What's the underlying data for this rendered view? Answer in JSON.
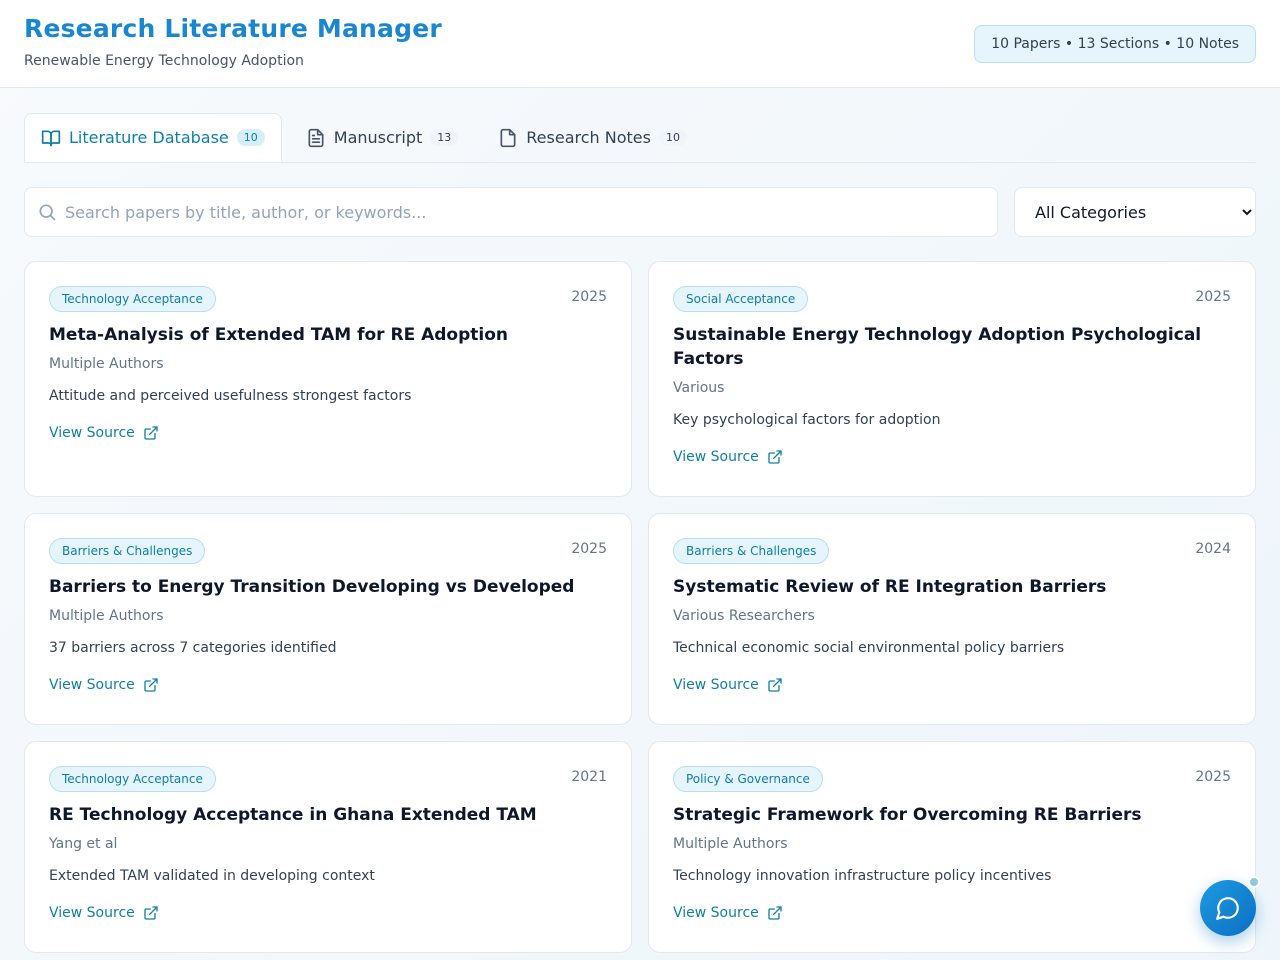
{
  "header": {
    "title": "Research Literature Manager",
    "subtitle": "Renewable Energy Technology Adoption",
    "stats": "10 Papers • 13 Sections • 10 Notes"
  },
  "tabs": [
    {
      "label": "Literature Database",
      "count": "10",
      "icon": "book-open-icon",
      "active": true
    },
    {
      "label": "Manuscript",
      "count": "13",
      "icon": "document-text-icon",
      "active": false
    },
    {
      "label": "Research Notes",
      "count": "10",
      "icon": "file-icon",
      "active": false
    }
  ],
  "search": {
    "placeholder": "Search papers by title, author, or keywords...",
    "value": ""
  },
  "filter": {
    "selected": "All Categories"
  },
  "papers": [
    {
      "category": "Technology Acceptance",
      "year": "2025",
      "title": "Meta-Analysis of Extended TAM for RE Adoption",
      "authors": "Multiple Authors",
      "summary": "Attitude and perceived usefulness strongest factors",
      "link_label": "View Source"
    },
    {
      "category": "Social Acceptance",
      "year": "2025",
      "title": "Sustainable Energy Technology Adoption Psychological Factors",
      "authors": "Various",
      "summary": "Key psychological factors for adoption",
      "link_label": "View Source"
    },
    {
      "category": "Barriers & Challenges",
      "year": "2025",
      "title": "Barriers to Energy Transition Developing vs Developed",
      "authors": "Multiple Authors",
      "summary": "37 barriers across 7 categories identified",
      "link_label": "View Source"
    },
    {
      "category": "Barriers & Challenges",
      "year": "2024",
      "title": "Systematic Review of RE Integration Barriers",
      "authors": "Various Researchers",
      "summary": "Technical economic social environmental policy barriers",
      "link_label": "View Source"
    },
    {
      "category": "Technology Acceptance",
      "year": "2021",
      "title": "RE Technology Acceptance in Ghana Extended TAM",
      "authors": "Yang et al",
      "summary": "Extended TAM validated in developing context",
      "link_label": "View Source"
    },
    {
      "category": "Policy & Governance",
      "year": "2025",
      "title": "Strategic Framework for Overcoming RE Barriers",
      "authors": "Multiple Authors",
      "summary": "Technology innovation infrastructure policy incentives",
      "link_label": "View Source"
    }
  ],
  "colors": {
    "accent": "#1a86cf",
    "link": "#0e7fa8",
    "badge_bg": "#e6f4fb"
  },
  "chat_button": {
    "icon": "chat-bubble-icon"
  }
}
